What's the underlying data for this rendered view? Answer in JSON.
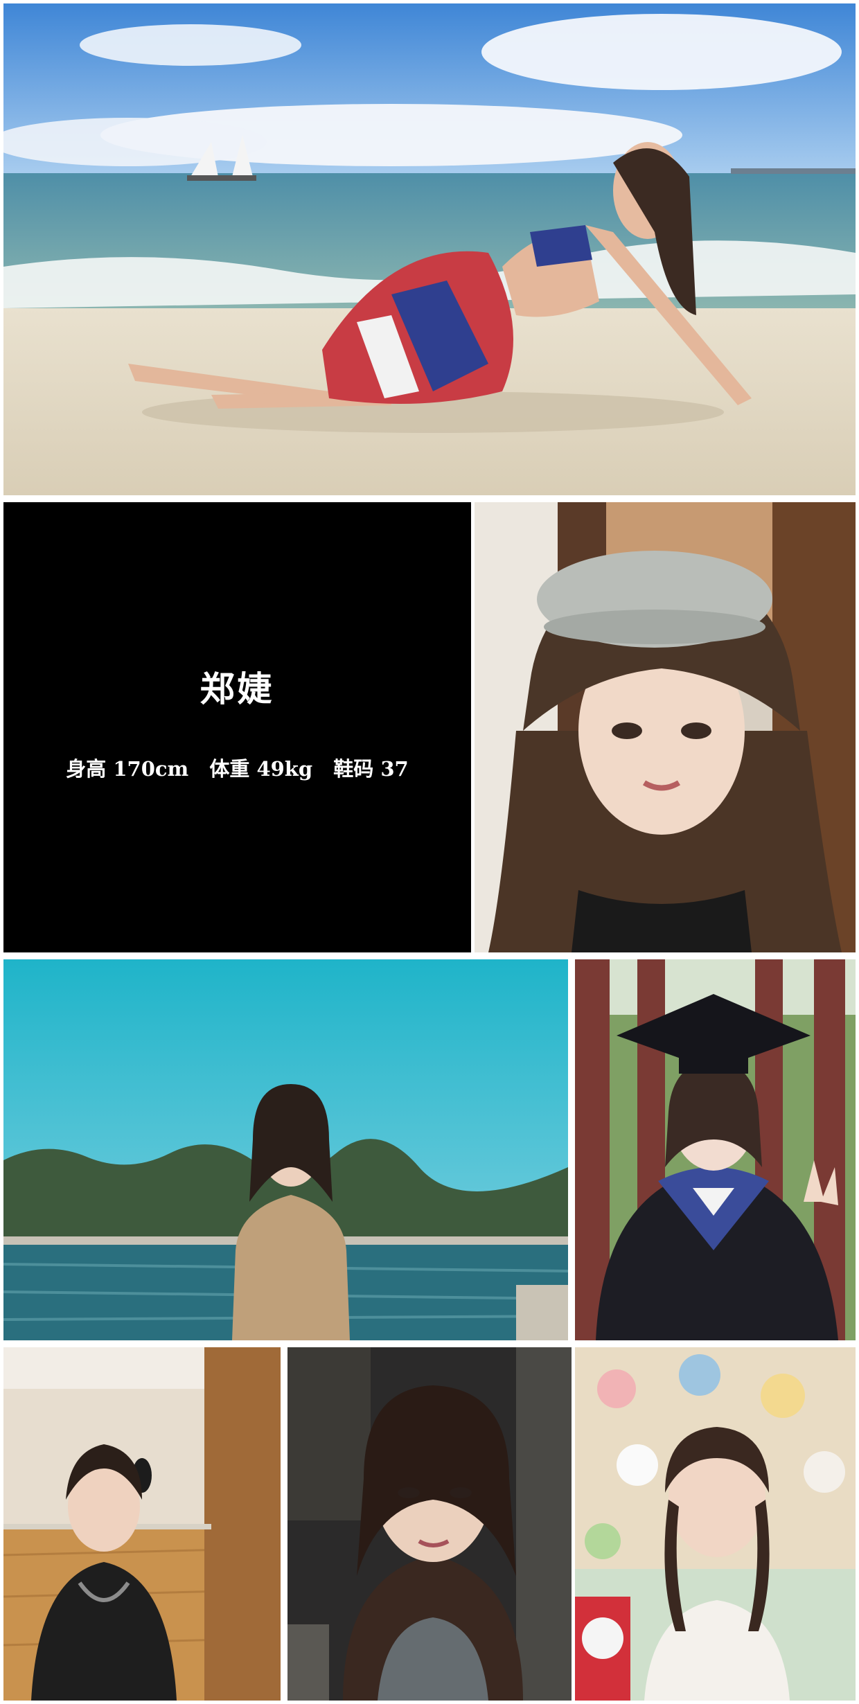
{
  "profile": {
    "name": "郑婕",
    "stats": {
      "height": "身高 170cm",
      "weight": "体重 49kg",
      "shoe_size": "鞋码 37"
    }
  },
  "colors": {
    "frame": "#ffffff",
    "info_panel_background": "#000000",
    "info_text": "#ffffff"
  }
}
